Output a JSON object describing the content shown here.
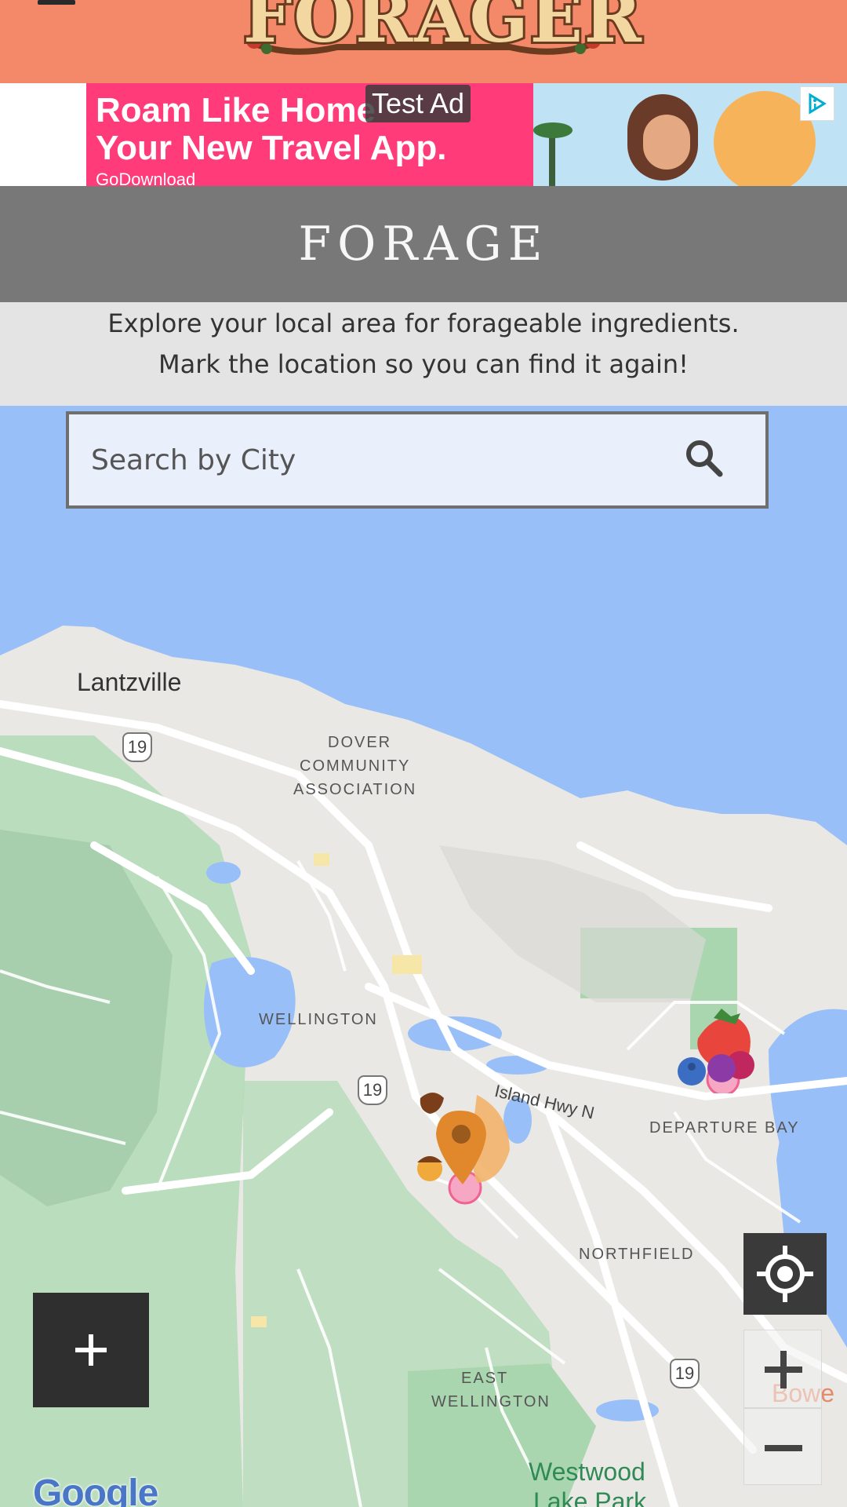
{
  "app": {
    "logo_text": "FORAGER",
    "menu_icon": "hamburger-menu-icon"
  },
  "ad": {
    "line1": "Roam Like Home",
    "line2": "Your New Travel App.",
    "line3": "GoDownload",
    "tag": "Test Ad",
    "adchoices_icon": "adchoices-icon"
  },
  "page": {
    "title": "FORAGE",
    "description_line1": "Explore your local area for forageable ingredients.",
    "description_line2": "Mark the location so you can find it again!"
  },
  "search": {
    "placeholder": "Search by City",
    "value": "",
    "icon": "search-icon"
  },
  "map": {
    "labels": {
      "lantzville": "Lantzville",
      "dover": "DOVER",
      "community": "COMMUNITY",
      "association": "ASSOCIATION",
      "wellington": "WELLINGTON",
      "island_hwy": "Island Hwy N",
      "departure_bay": "DEPARTURE BAY",
      "northfield": "NORTHFIELD",
      "east": "EAST",
      "east_wellington": "WELLINGTON",
      "westwood": "Westwood",
      "lake_park": "Lake Park",
      "bowen": "Bowe"
    },
    "highway_shields": [
      "19",
      "19",
      "19"
    ],
    "attribution": "Google",
    "colors": {
      "water": "#99bff8",
      "land": "#e8e8e6",
      "park": "#a8d5b1",
      "road": "#ffffff"
    }
  },
  "controls": {
    "add_icon": "plus-icon",
    "locate_icon": "my-location-icon",
    "zoom_in_icon": "zoom-in-icon",
    "zoom_out_icon": "zoom-out-icon"
  },
  "markers": [
    {
      "name": "berries-marker",
      "kind": "strawberry, blueberry, raspberry"
    },
    {
      "name": "acorn-mushroom-marker",
      "kind": "acorn, chanterelle, pin"
    }
  ]
}
